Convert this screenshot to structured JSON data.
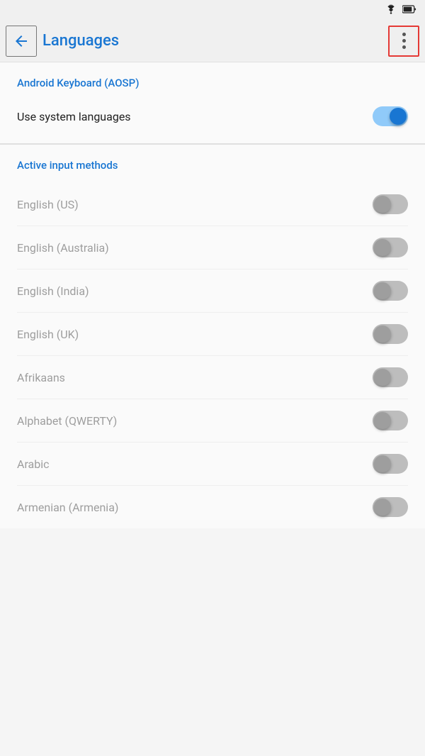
{
  "statusBar": {
    "wifi": "wifi-icon",
    "battery": "battery-icon"
  },
  "header": {
    "backLabel": "←",
    "title": "Languages",
    "moreOptions": "more-options"
  },
  "keyboardSection": {
    "title": "Android Keyboard (AOSP)",
    "useSystemLanguages": {
      "label": "Use system languages",
      "enabled": true
    }
  },
  "activeInputMethods": {
    "sectionTitle": "Active input methods",
    "items": [
      {
        "label": "English (US)",
        "enabled": false
      },
      {
        "label": "English (Australia)",
        "enabled": false
      },
      {
        "label": "English (India)",
        "enabled": false
      },
      {
        "label": "English (UK)",
        "enabled": false
      },
      {
        "label": "Afrikaans",
        "enabled": false
      },
      {
        "label": "Alphabet (QWERTY)",
        "enabled": false
      },
      {
        "label": "Arabic",
        "enabled": false
      },
      {
        "label": "Armenian (Armenia)",
        "enabled": false
      }
    ]
  },
  "colors": {
    "accent": "#1976d2",
    "toggleOn": "#1976d2",
    "toggleOff": "#9e9e9e",
    "textPrimary": "#212121",
    "textSecondary": "#9e9e9e",
    "redBorder": "#e53935"
  }
}
